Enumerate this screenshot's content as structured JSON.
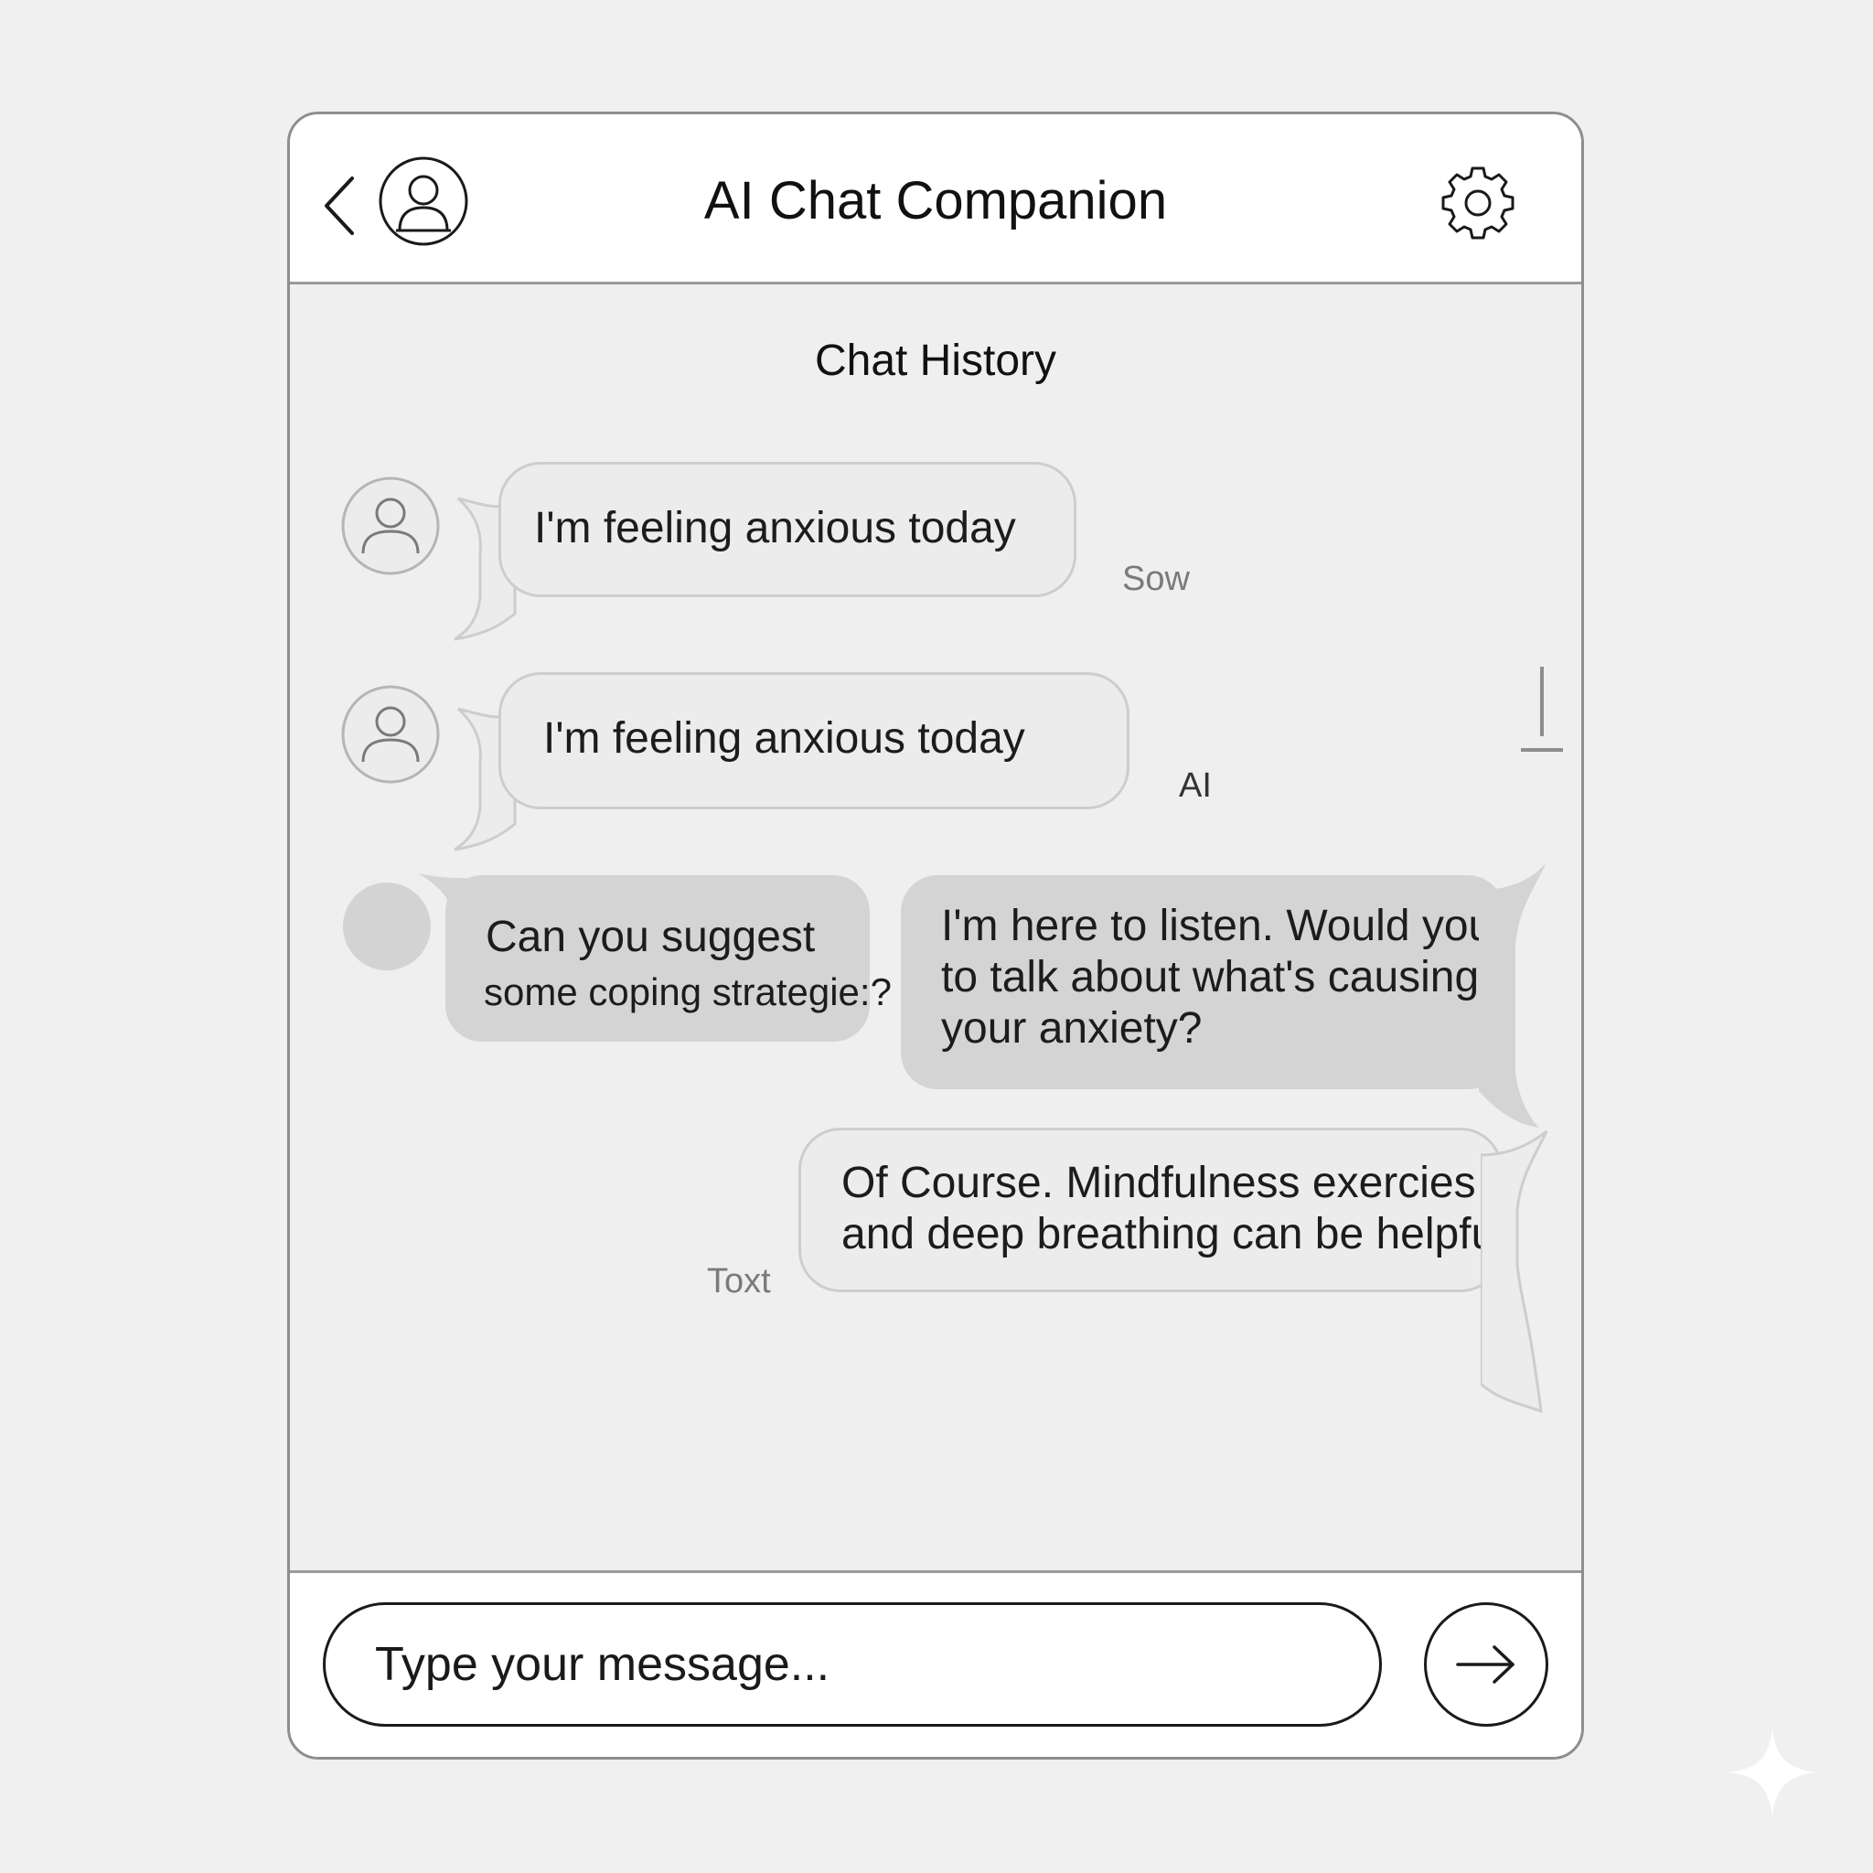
{
  "header": {
    "title": "AI Chat Companion",
    "back_icon": "chevron-left-icon",
    "avatar_icon": "user-avatar-icon",
    "settings_icon": "gear-icon"
  },
  "history": {
    "title": "Chat History"
  },
  "messages": [
    {
      "text": "I'm feeling anxious today",
      "meta": "Sow"
    },
    {
      "text": "I'm feeling anxious today",
      "meta": "AI"
    },
    {
      "text_line1": "Can you suggest",
      "text_line2": "some coping strategie:?"
    },
    {
      "text": "I'm here to listen. Would you\nto talk about what's causing\nyour anxiety?"
    },
    {
      "text": "Of Course. Mindfulness exercies\nand deep breathing can be helpful.",
      "meta": "Toxt"
    }
  ],
  "composer": {
    "placeholder": "Type your message...",
    "send_icon": "arrow-right-icon"
  },
  "colors": {
    "background": "#f0f0f0",
    "panel": "#efefef",
    "bubble_light": "#ececec",
    "bubble_dark": "#d4d4d4",
    "border": "#8e8e8e"
  }
}
